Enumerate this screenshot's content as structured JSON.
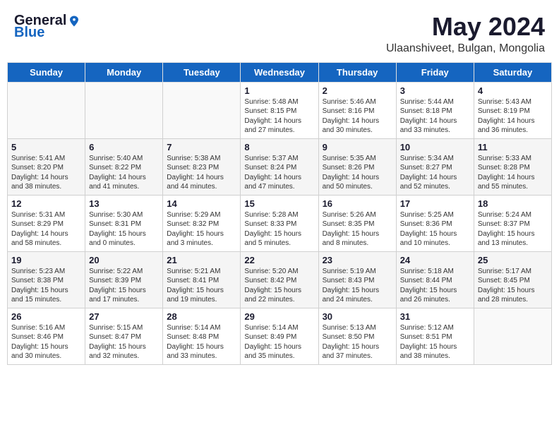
{
  "header": {
    "logo_general": "General",
    "logo_blue": "Blue",
    "title": "May 2024",
    "subtitle": "Ulaanshiveet, Bulgan, Mongolia"
  },
  "days_of_week": [
    "Sunday",
    "Monday",
    "Tuesday",
    "Wednesday",
    "Thursday",
    "Friday",
    "Saturday"
  ],
  "weeks": [
    [
      {
        "day": "",
        "info": ""
      },
      {
        "day": "",
        "info": ""
      },
      {
        "day": "",
        "info": ""
      },
      {
        "day": "1",
        "info": "Sunrise: 5:48 AM\nSunset: 8:15 PM\nDaylight: 14 hours\nand 27 minutes."
      },
      {
        "day": "2",
        "info": "Sunrise: 5:46 AM\nSunset: 8:16 PM\nDaylight: 14 hours\nand 30 minutes."
      },
      {
        "day": "3",
        "info": "Sunrise: 5:44 AM\nSunset: 8:18 PM\nDaylight: 14 hours\nand 33 minutes."
      },
      {
        "day": "4",
        "info": "Sunrise: 5:43 AM\nSunset: 8:19 PM\nDaylight: 14 hours\nand 36 minutes."
      }
    ],
    [
      {
        "day": "5",
        "info": "Sunrise: 5:41 AM\nSunset: 8:20 PM\nDaylight: 14 hours\nand 38 minutes."
      },
      {
        "day": "6",
        "info": "Sunrise: 5:40 AM\nSunset: 8:22 PM\nDaylight: 14 hours\nand 41 minutes."
      },
      {
        "day": "7",
        "info": "Sunrise: 5:38 AM\nSunset: 8:23 PM\nDaylight: 14 hours\nand 44 minutes."
      },
      {
        "day": "8",
        "info": "Sunrise: 5:37 AM\nSunset: 8:24 PM\nDaylight: 14 hours\nand 47 minutes."
      },
      {
        "day": "9",
        "info": "Sunrise: 5:35 AM\nSunset: 8:26 PM\nDaylight: 14 hours\nand 50 minutes."
      },
      {
        "day": "10",
        "info": "Sunrise: 5:34 AM\nSunset: 8:27 PM\nDaylight: 14 hours\nand 52 minutes."
      },
      {
        "day": "11",
        "info": "Sunrise: 5:33 AM\nSunset: 8:28 PM\nDaylight: 14 hours\nand 55 minutes."
      }
    ],
    [
      {
        "day": "12",
        "info": "Sunrise: 5:31 AM\nSunset: 8:29 PM\nDaylight: 14 hours\nand 58 minutes."
      },
      {
        "day": "13",
        "info": "Sunrise: 5:30 AM\nSunset: 8:31 PM\nDaylight: 15 hours\nand 0 minutes."
      },
      {
        "day": "14",
        "info": "Sunrise: 5:29 AM\nSunset: 8:32 PM\nDaylight: 15 hours\nand 3 minutes."
      },
      {
        "day": "15",
        "info": "Sunrise: 5:28 AM\nSunset: 8:33 PM\nDaylight: 15 hours\nand 5 minutes."
      },
      {
        "day": "16",
        "info": "Sunrise: 5:26 AM\nSunset: 8:35 PM\nDaylight: 15 hours\nand 8 minutes."
      },
      {
        "day": "17",
        "info": "Sunrise: 5:25 AM\nSunset: 8:36 PM\nDaylight: 15 hours\nand 10 minutes."
      },
      {
        "day": "18",
        "info": "Sunrise: 5:24 AM\nSunset: 8:37 PM\nDaylight: 15 hours\nand 13 minutes."
      }
    ],
    [
      {
        "day": "19",
        "info": "Sunrise: 5:23 AM\nSunset: 8:38 PM\nDaylight: 15 hours\nand 15 minutes."
      },
      {
        "day": "20",
        "info": "Sunrise: 5:22 AM\nSunset: 8:39 PM\nDaylight: 15 hours\nand 17 minutes."
      },
      {
        "day": "21",
        "info": "Sunrise: 5:21 AM\nSunset: 8:41 PM\nDaylight: 15 hours\nand 19 minutes."
      },
      {
        "day": "22",
        "info": "Sunrise: 5:20 AM\nSunset: 8:42 PM\nDaylight: 15 hours\nand 22 minutes."
      },
      {
        "day": "23",
        "info": "Sunrise: 5:19 AM\nSunset: 8:43 PM\nDaylight: 15 hours\nand 24 minutes."
      },
      {
        "day": "24",
        "info": "Sunrise: 5:18 AM\nSunset: 8:44 PM\nDaylight: 15 hours\nand 26 minutes."
      },
      {
        "day": "25",
        "info": "Sunrise: 5:17 AM\nSunset: 8:45 PM\nDaylight: 15 hours\nand 28 minutes."
      }
    ],
    [
      {
        "day": "26",
        "info": "Sunrise: 5:16 AM\nSunset: 8:46 PM\nDaylight: 15 hours\nand 30 minutes."
      },
      {
        "day": "27",
        "info": "Sunrise: 5:15 AM\nSunset: 8:47 PM\nDaylight: 15 hours\nand 32 minutes."
      },
      {
        "day": "28",
        "info": "Sunrise: 5:14 AM\nSunset: 8:48 PM\nDaylight: 15 hours\nand 33 minutes."
      },
      {
        "day": "29",
        "info": "Sunrise: 5:14 AM\nSunset: 8:49 PM\nDaylight: 15 hours\nand 35 minutes."
      },
      {
        "day": "30",
        "info": "Sunrise: 5:13 AM\nSunset: 8:50 PM\nDaylight: 15 hours\nand 37 minutes."
      },
      {
        "day": "31",
        "info": "Sunrise: 5:12 AM\nSunset: 8:51 PM\nDaylight: 15 hours\nand 38 minutes."
      },
      {
        "day": "",
        "info": ""
      }
    ]
  ]
}
